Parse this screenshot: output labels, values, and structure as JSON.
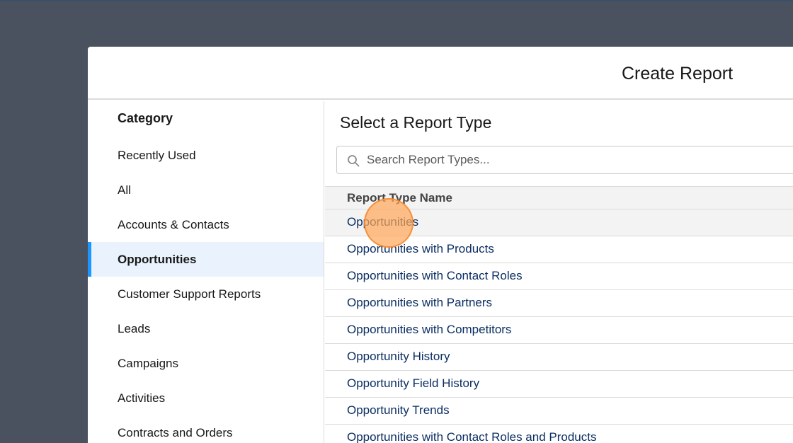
{
  "modal": {
    "title": "Create Report"
  },
  "sidebar": {
    "heading": "Category",
    "items": [
      {
        "label": "Recently Used",
        "active": false
      },
      {
        "label": "All",
        "active": false
      },
      {
        "label": "Accounts & Contacts",
        "active": false
      },
      {
        "label": "Opportunities",
        "active": true
      },
      {
        "label": "Customer Support Reports",
        "active": false
      },
      {
        "label": "Leads",
        "active": false
      },
      {
        "label": "Campaigns",
        "active": false
      },
      {
        "label": "Activities",
        "active": false
      },
      {
        "label": "Contracts and Orders",
        "active": false
      }
    ]
  },
  "main": {
    "heading": "Select a Report Type",
    "search": {
      "placeholder": "Search Report Types...",
      "value": "",
      "icon": "search-icon"
    },
    "table": {
      "column_header": "Report Type Name",
      "rows": [
        "Opportunities",
        "Opportunities with Products",
        "Opportunities with Contact Roles",
        "Opportunities with Partners",
        "Opportunities with Competitors",
        "Opportunity History",
        "Opportunity Field History",
        "Opportunity Trends",
        "Opportunities with Contact Roles and Products"
      ],
      "hovered_row": 0
    }
  },
  "colors": {
    "backdrop": "#4b525f",
    "active_accent": "#1b96ff",
    "active_bg": "#eaf3fd",
    "link": "#0b2e63",
    "click_marker": "#ffa757"
  }
}
